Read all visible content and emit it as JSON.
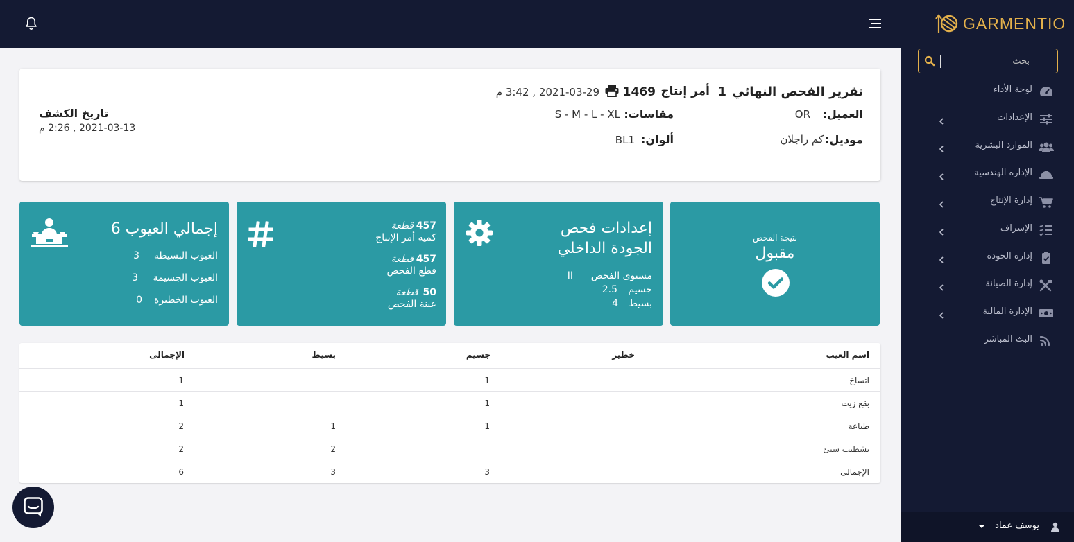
{
  "app": {
    "name": "GARMENTIO"
  },
  "colors": {
    "navy": "#141a33",
    "gold": "#e3b04b",
    "teal": "#2b9aa4"
  },
  "search": {
    "placeholder": "بحث"
  },
  "sidebar": {
    "items": [
      {
        "label": "لوحة الأداء",
        "icon": "dashboard-icon",
        "has_arrow": false
      },
      {
        "label": "الإعدادات",
        "icon": "sliders-icon",
        "has_arrow": true
      },
      {
        "label": "الموارد البشرية",
        "icon": "users-icon",
        "has_arrow": true
      },
      {
        "label": "الإدارة الهندسية",
        "icon": "hard-hat-icon",
        "has_arrow": true
      },
      {
        "label": "إدارة الإنتاج",
        "icon": "cart-icon",
        "has_arrow": true
      },
      {
        "label": "الإشراف",
        "icon": "tasks-icon",
        "has_arrow": true
      },
      {
        "label": "إدارة الجودة",
        "icon": "clipboard-check-icon",
        "has_arrow": true
      },
      {
        "label": "إدارة الصيانة",
        "icon": "tools-icon",
        "has_arrow": true
      },
      {
        "label": "الإدارة المالية",
        "icon": "money-icon",
        "has_arrow": true
      },
      {
        "label": "البث المباشر",
        "icon": "rss-icon",
        "has_arrow": false
      }
    ]
  },
  "user": {
    "name": "يوسف عماد"
  },
  "report": {
    "title": "تقرير الفحص النهائي",
    "title_num": "1",
    "order_label": "أمر إنتاج",
    "order_no": "1469",
    "created": "2021-03-29 , 3:42 م",
    "client_label": "العميل:",
    "client": "OR",
    "sizes_label": "مقاسات:",
    "sizes": "S - M - L - XL",
    "model_label": "موديل:",
    "model": "كم راجلان",
    "colors_label": "ألوان:",
    "colors": "BL1",
    "inspection_date_label": "تاريخ الكشف",
    "inspection_date": "2021-03-13 , 2:26 م"
  },
  "cards": {
    "result": {
      "label": "نتيجة الفحص",
      "value": "مقبول"
    },
    "settings": {
      "title1": "إعدادات فحص",
      "title2": "الجودة الداخلي",
      "level_label": "مستوى الفحص",
      "level": "II",
      "major_label": "جسيم",
      "major": "2.5",
      "minor_label": "بسيط",
      "minor": "4"
    },
    "quantities": {
      "unit": "قطعة",
      "order_qty": "457",
      "order_qty_label": "كمية أمر الإنتاج",
      "inspected_qty": "457",
      "inspected_qty_label": "قطع الفحص",
      "sample_qty": "50",
      "sample_qty_label": "عينة الفحص"
    },
    "defects": {
      "title": "إجمالي العيوب 6",
      "minor_label": "العيوب البسيطة",
      "minor": "3",
      "major_label": "العيوب الجسيمة",
      "major": "3",
      "critical_label": "العيوب الخطيرة",
      "critical": "0"
    }
  },
  "table": {
    "headers": [
      "اسم العيب",
      "خطير",
      "جسيم",
      "بسيط",
      "الإجمالى"
    ],
    "rows": [
      [
        "اتساخ",
        "",
        "1",
        "",
        "1"
      ],
      [
        "بقع زيت",
        "",
        "1",
        "",
        "1"
      ],
      [
        "طباعة",
        "",
        "1",
        "1",
        "2"
      ],
      [
        "تشطيب سيئ",
        "",
        "",
        "2",
        "2"
      ],
      [
        "الإجمالى",
        "",
        "3",
        "3",
        "6"
      ]
    ]
  }
}
